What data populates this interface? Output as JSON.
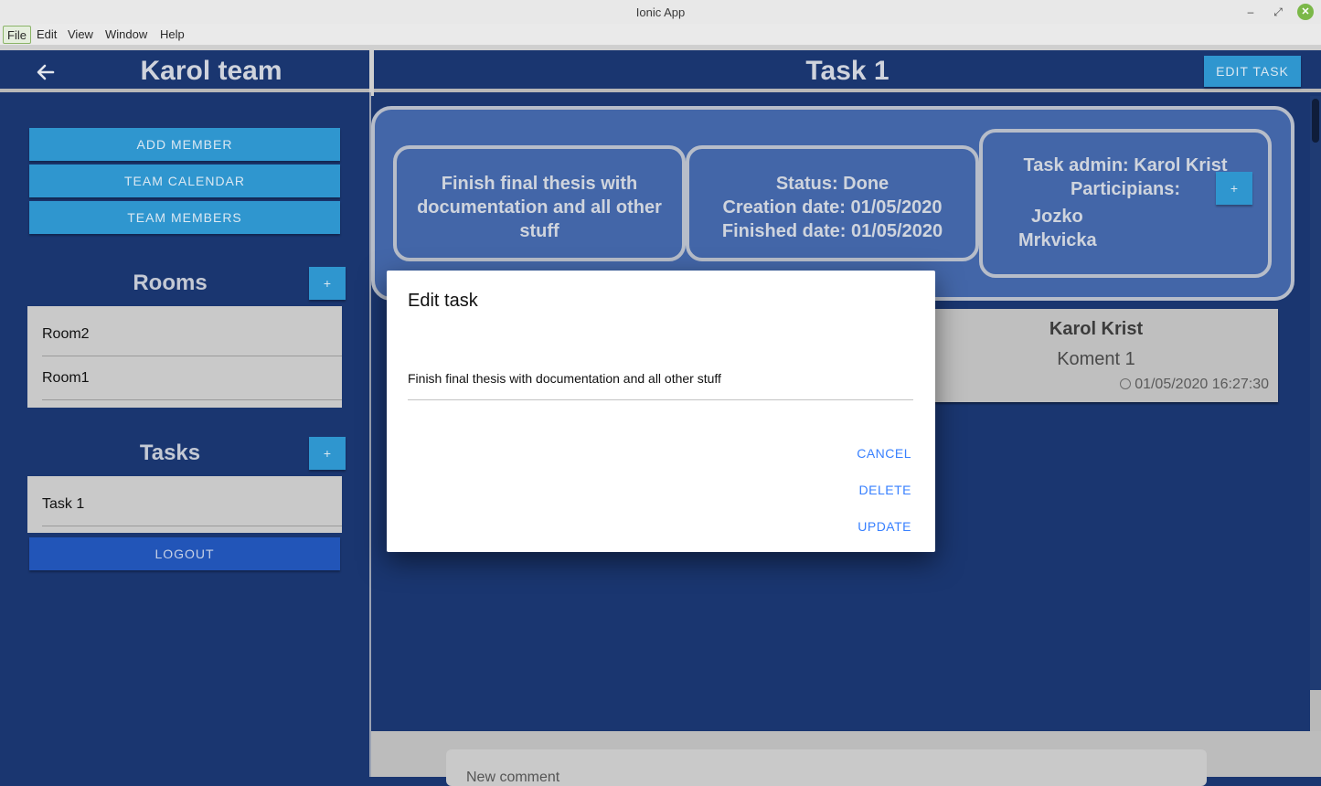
{
  "window": {
    "title": "Ionic App",
    "menu": [
      "File",
      "Edit",
      "View",
      "Window",
      "Help"
    ],
    "min_glyph": "–",
    "max_glyph": "⤢",
    "close_glyph": "✕"
  },
  "sidebar": {
    "team_title": "Karol team",
    "buttons": [
      "ADD MEMBER",
      "TEAM CALENDAR",
      "TEAM MEMBERS"
    ],
    "rooms": {
      "title": "Rooms",
      "add_label": "+",
      "items": [
        "Room2",
        "Room1"
      ]
    },
    "tasks": {
      "title": "Tasks",
      "add_label": "+",
      "items": [
        "Task 1"
      ]
    },
    "logout_label": "LOGOUT"
  },
  "main": {
    "title": "Task 1",
    "edit_task_label": "EDIT TASK",
    "description": [
      "Finish final thesis with",
      "documentation and all other",
      "stuff"
    ],
    "status": [
      "Status: Done",
      "Creation date: 01/05/2020",
      "Finished date: 01/05/2020"
    ],
    "admin": [
      "Task admin: Karol Krist",
      "Participians:"
    ],
    "participants": [
      "Jozko",
      "Mrkvicka"
    ],
    "add_participant_label": "+",
    "comment": {
      "author": "Karol Krist",
      "text": "Koment 1",
      "time": "01/05/2020 16:27:30"
    },
    "new_comment_placeholder": "New comment"
  },
  "modal": {
    "title": "Edit task",
    "input_value": "Finish final thesis with documentation and all other stuff",
    "cancel_label": "CANCEL",
    "delete_label": "DELETE",
    "update_label": "UPDATE"
  },
  "colors": {
    "background": "#1a3670",
    "button": "#2f96cf",
    "logout": "#2255b8",
    "panel": "#4366a8",
    "modal_action": "#3880ff"
  }
}
